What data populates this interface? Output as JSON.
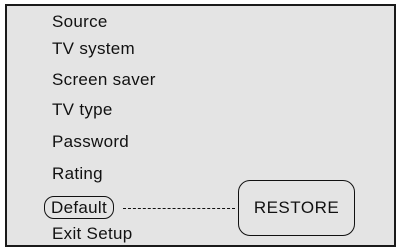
{
  "menu": {
    "items": [
      {
        "label": "Source"
      },
      {
        "label": "TV system"
      },
      {
        "label": "Screen saver"
      },
      {
        "label": "TV type"
      },
      {
        "label": "Password"
      },
      {
        "label": "Rating"
      },
      {
        "label": "Default"
      },
      {
        "label": "Exit Setup"
      }
    ],
    "selected_index": 6
  },
  "callout": {
    "label": "RESTORE"
  }
}
